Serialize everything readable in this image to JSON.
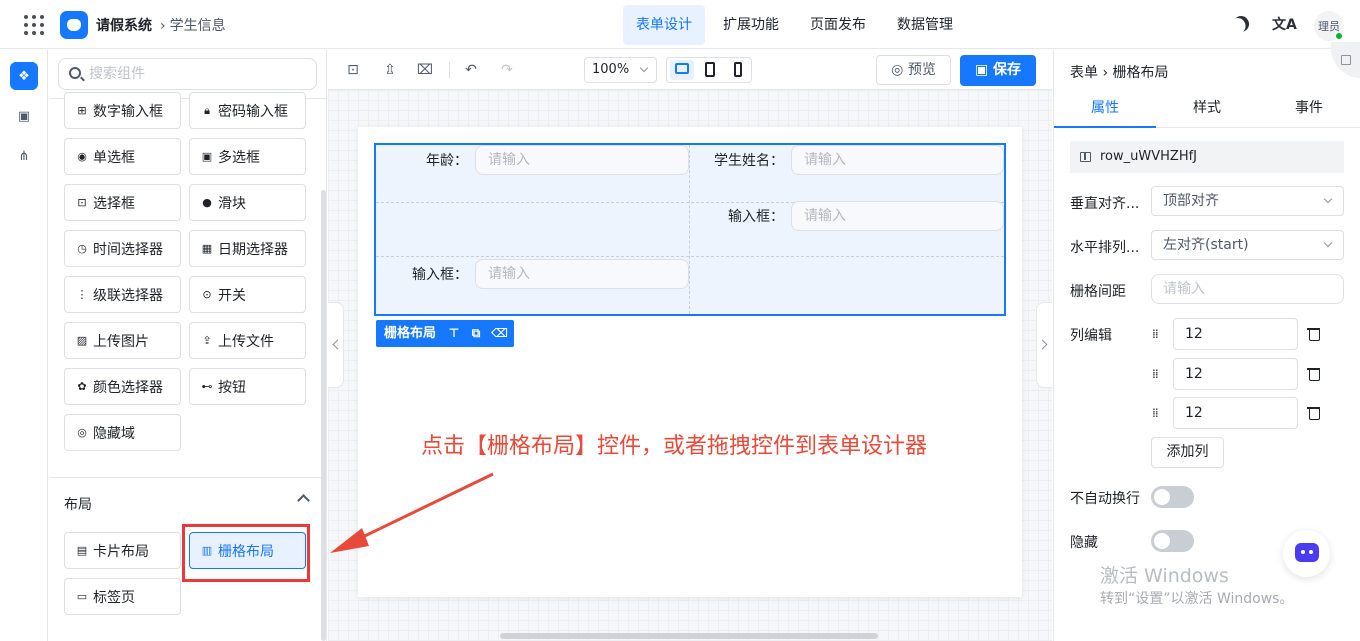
{
  "header": {
    "app_title": "请假系统",
    "breadcrumb": "学生信息",
    "tabs": [
      {
        "label": "表单设计",
        "active": true
      },
      {
        "label": "扩展功能",
        "active": false
      },
      {
        "label": "页面发布",
        "active": false
      },
      {
        "label": "数据管理",
        "active": false
      }
    ],
    "translate_label": "文A",
    "user": "理员"
  },
  "components": {
    "search_placeholder": "搜索组件",
    "items": [
      {
        "label": "数字输入框",
        "icon": "number-input-icon"
      },
      {
        "label": "密码输入框",
        "icon": "lock-icon"
      },
      {
        "label": "单选框",
        "icon": "radio-icon"
      },
      {
        "label": "多选框",
        "icon": "checkbox-icon"
      },
      {
        "label": "选择框",
        "icon": "select-icon"
      },
      {
        "label": "滑块",
        "icon": "slider-icon"
      },
      {
        "label": "时间选择器",
        "icon": "clock-icon"
      },
      {
        "label": "日期选择器",
        "icon": "calendar-icon"
      },
      {
        "label": "级联选择器",
        "icon": "cascader-icon"
      },
      {
        "label": "开关",
        "icon": "switch-icon"
      },
      {
        "label": "上传图片",
        "icon": "image-icon"
      },
      {
        "label": "上传文件",
        "icon": "upload-icon"
      },
      {
        "label": "颜色选择器",
        "icon": "palette-icon"
      },
      {
        "label": "按钮",
        "icon": "button-icon"
      },
      {
        "label": "隐藏域",
        "icon": "eye-off-icon"
      }
    ],
    "layout_section": {
      "title": "布局",
      "items": [
        {
          "label": "卡片布局",
          "icon": "card-icon"
        },
        {
          "label": "栅格布局",
          "icon": "grid-layout-icon",
          "selected": true
        },
        {
          "label": "标签页",
          "icon": "tabs-icon"
        }
      ]
    }
  },
  "toolbar": {
    "zoom": "100%",
    "preview_label": "预览",
    "save_label": "保存"
  },
  "form": {
    "fields": [
      {
        "label": "年龄：",
        "placeholder": "请输入"
      },
      {
        "label": "学生姓名：",
        "placeholder": "请输入"
      },
      {
        "label": "输入框：",
        "placeholder": "请输入"
      },
      {
        "label": "输入框：",
        "placeholder": "请输入"
      }
    ],
    "grid_tag_label": "栅格布局"
  },
  "annotation": "点击【栅格布局】控件，或者拖拽控件到表单设计器",
  "properties": {
    "breadcrumb_root": "表单",
    "breadcrumb_leaf": "栅格布局",
    "tabs": [
      {
        "label": "属性",
        "active": true
      },
      {
        "label": "样式",
        "active": false
      },
      {
        "label": "事件",
        "active": false
      }
    ],
    "row_id": "row_uWVHZHfJ",
    "vertical_align_label": "垂直对齐...",
    "vertical_align_value": "顶部对齐",
    "horizontal_label": "水平排列...",
    "horizontal_value": "左对齐(start)",
    "gutter_label": "栅格间距",
    "gutter_placeholder": "请输入",
    "columns_label": "列编辑",
    "columns": [
      "12",
      "12",
      "12"
    ],
    "add_column_label": "添加列",
    "no_wrap_label": "不自动换行",
    "hidden_label": "隐藏"
  },
  "watermark": {
    "line1": "激活 Windows",
    "line2": "转到“设置”以激活 Windows。"
  },
  "colors": {
    "accent": "#1677ff",
    "annotation": "#e84a3a"
  }
}
